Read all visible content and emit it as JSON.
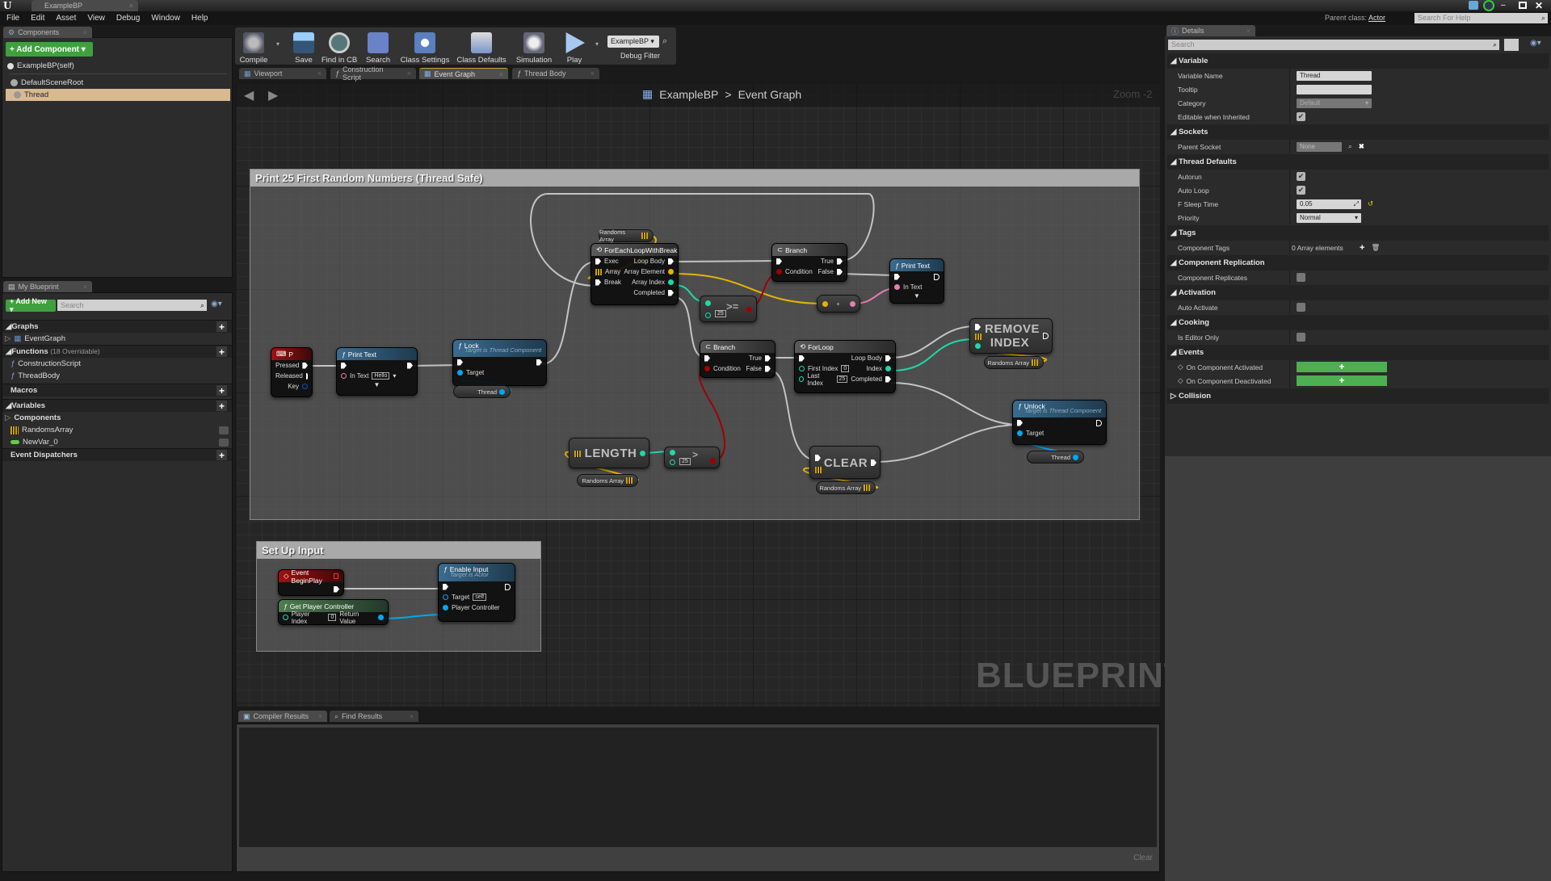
{
  "window": {
    "logo": "U",
    "tab_title": "ExampleBP",
    "parent_class_label": "Parent class:",
    "parent_class_value": "Actor",
    "help_search_placeholder": "Search For Help"
  },
  "menu": [
    "File",
    "Edit",
    "Asset",
    "View",
    "Debug",
    "Window",
    "Help"
  ],
  "components_panel": {
    "tab": "Components",
    "add_button": "+ Add Component ▾",
    "items": [
      "ExampleBP(self)",
      "DefaultSceneRoot",
      "Thread"
    ],
    "selected": "Thread",
    "selected_color": "#d8b991"
  },
  "my_blueprint": {
    "tab": "My Blueprint",
    "add_button": "+ Add New ▾",
    "search_placeholder": "Search",
    "graphs": {
      "label": "Graphs",
      "items": [
        "EventGraph"
      ]
    },
    "functions": {
      "label": "Functions",
      "note": "(18 Overridable)",
      "items": [
        "ConstructionScript",
        "ThreadBody"
      ]
    },
    "macros": {
      "label": "Macros"
    },
    "variables": {
      "label": "Variables",
      "group": "Components",
      "items": [
        "RandomsArray",
        "NewVar_0"
      ]
    },
    "dispatchers": {
      "label": "Event Dispatchers"
    }
  },
  "toolbar": {
    "compile": "Compile",
    "save": "Save",
    "find_in_cb": "Find in CB",
    "search": "Search",
    "class_settings": "Class Settings",
    "class_defaults": "Class Defaults",
    "simulation": "Simulation",
    "play": "Play",
    "debug_select": "ExampleBP ▾",
    "debug_filter": "Debug Filter"
  },
  "graph_tabs": [
    "Viewport",
    "Construction Script",
    "Event Graph",
    "Thread Body"
  ],
  "active_graph_tab": "Event Graph",
  "breadcrumb": {
    "root": "ExampleBP",
    "sep": ">",
    "current": "Event Graph"
  },
  "zoom_label": "Zoom -2",
  "watermark": "BLUEPRINT",
  "graph": {
    "comment1": "Print 25 First Random Numbers (Thread Safe)",
    "comment2": "Set Up Input",
    "key_p": {
      "title": "P",
      "pressed": "Pressed",
      "released": "Released",
      "key": "Key"
    },
    "print1": {
      "title": "Print Text",
      "in_text": "In Text",
      "value": "Hello"
    },
    "lock": {
      "title": "Lock",
      "subtitle": "Target is Thread Component",
      "target": "Target"
    },
    "thread_getter": "Thread",
    "randoms_getter": "Randoms Array",
    "foreach": {
      "title": "ForEachLoopWithBreak",
      "exec": "Exec",
      "array": "Array",
      "break": "Break",
      "loop_body": "Loop Body",
      "array_element": "Array Element",
      "array_index": "Array Index",
      "completed": "Completed"
    },
    "gte": {
      "op": ">=",
      "value": "25"
    },
    "branch": {
      "title": "Branch",
      "condition": "Condition",
      "true": "True",
      "false": "False"
    },
    "print2": {
      "title": "Print Text",
      "in_text": "In Text"
    },
    "forloop": {
      "title": "ForLoop",
      "first_index": "First Index",
      "first_value": "0",
      "last_index": "Last Index",
      "last_value": "25",
      "loop_body": "Loop Body",
      "index": "Index",
      "completed": "Completed"
    },
    "remove_index": "REMOVE INDEX",
    "unlock": {
      "title": "Unlock",
      "subtitle": "Target is Thread Component",
      "target": "Target"
    },
    "length": "LENGTH",
    "gt": {
      "op": ">",
      "value": "25"
    },
    "clear": "CLEAR",
    "begin_play": {
      "title": "Event BeginPlay"
    },
    "get_pc": {
      "title": "Get Player Controller",
      "player_index": "Player Index",
      "index_value": "0",
      "return_value": "Return Value"
    },
    "enable_input": {
      "title": "Enable Input",
      "subtitle": "Target is Actor",
      "target": "Target",
      "target_value": "self",
      "player_controller": "Player Controller"
    }
  },
  "bottom": {
    "tabs": [
      "Compiler Results",
      "Find Results"
    ],
    "clear": "Clear"
  },
  "details": {
    "tab": "Details",
    "search_placeholder": "Search",
    "variable": {
      "label": "Variable",
      "name_label": "Variable Name",
      "name_value": "Thread",
      "tooltip_label": "Tooltip",
      "tooltip_value": "",
      "category_label": "Category",
      "category_value": "Default",
      "editable_label": "Editable when Inherited",
      "editable": true
    },
    "sockets": {
      "label": "Sockets",
      "parent_label": "Parent Socket",
      "parent_value": "None"
    },
    "thread_defaults": {
      "label": "Thread Defaults",
      "autorun_label": "Autorun",
      "autorun": true,
      "autoloop_label": "Auto Loop",
      "autoloop": true,
      "sleep_label": "F Sleep Time",
      "sleep_value": "0.05",
      "priority_label": "Priority",
      "priority_value": "Normal"
    },
    "tags": {
      "label": "Tags",
      "comp_tags_label": "Component Tags",
      "comp_tags_value": "0 Array elements"
    },
    "replication": {
      "label": "Component Replication",
      "replicates_label": "Component Replicates",
      "replicates": false
    },
    "activation": {
      "label": "Activation",
      "auto_label": "Auto Activate",
      "auto": false
    },
    "cooking": {
      "label": "Cooking",
      "editor_only_label": "Is Editor Only",
      "editor_only": false
    },
    "events": {
      "label": "Events",
      "activated": "On Component Activated",
      "deactivated": "On Component Deactivated"
    },
    "collision": {
      "label": "Collision"
    }
  },
  "colors": {
    "exec": "#ffffff",
    "int": "#1ed9a8",
    "bool": "#a00000",
    "object": "#00a8f0",
    "text": "#e57fb0",
    "array": "#e6b400",
    "function_header": "#3a6b8f",
    "event_header": "#a01010",
    "add_green": "#4caf50"
  }
}
